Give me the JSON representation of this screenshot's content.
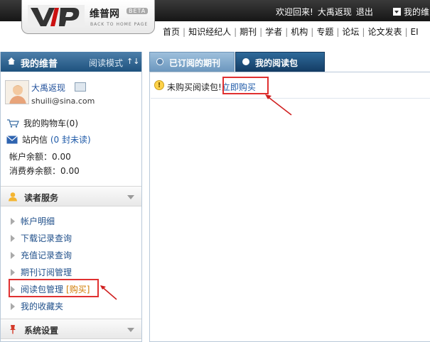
{
  "header": {
    "logo_text": "维普网",
    "logo_beta": "BETA",
    "logo_back": "BACK TO HOME PAGE",
    "welcome": "欢迎回来!",
    "username": "大禹返现",
    "logout": "退出",
    "my_vip": "我的维"
  },
  "nav": {
    "items": [
      "首页",
      "知识经纪人",
      "期刊",
      "学者",
      "机构",
      "专题",
      "论坛",
      "论文发表",
      "EI"
    ]
  },
  "sidebar": {
    "title": "我的维普",
    "mode": "阅读模式",
    "user": {
      "name": "大禹返现",
      "email": "shuili@sina.com"
    },
    "cart": "我的购物车(0)",
    "inbox_label": "站内信",
    "inbox_unread": "(0 封未读)",
    "balance": "帐户余额：0.00",
    "voucher": "消费券余额：0.00",
    "reader_service": {
      "title": "读者服务",
      "items": [
        {
          "label": "帐户明细"
        },
        {
          "label": "下载记录查询"
        },
        {
          "label": "充值记录查询"
        },
        {
          "label": "期刊订阅管理"
        },
        {
          "label": "阅读包管理",
          "extra": "[购买]"
        },
        {
          "label": "我的收藏夹"
        }
      ]
    },
    "system_settings": {
      "title": "系统设置"
    }
  },
  "main": {
    "tabs": [
      {
        "label": "已订阅的期刊"
      },
      {
        "label": "我的阅读包"
      }
    ],
    "notice": "未购买阅读包!",
    "buy_link": "立即购买"
  },
  "colors": {
    "header_bg": "#1c1c1c",
    "sidebar_head": "#2a5f8c",
    "active_tab": "#1b4672",
    "link": "#1f5aa8",
    "highlight_box": "#e03030"
  }
}
